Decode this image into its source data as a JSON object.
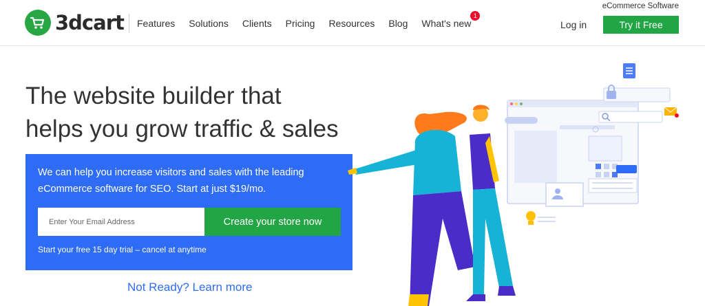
{
  "brand": {
    "logo_text": "3dcart",
    "tagline": "eCommerce Software",
    "colors": {
      "green": "#22a544",
      "blue": "#2f6cf6"
    }
  },
  "nav": {
    "items": [
      {
        "label": "Features"
      },
      {
        "label": "Solutions"
      },
      {
        "label": "Clients"
      },
      {
        "label": "Pricing"
      },
      {
        "label": "Resources"
      },
      {
        "label": "Blog"
      },
      {
        "label": "What's new",
        "badge": "1"
      }
    ],
    "login_label": "Log in",
    "try_label": "Try it Free"
  },
  "hero": {
    "title_line1": "The website builder that",
    "title_line2": "helps you grow traffic & sales",
    "description": "We can help you increase visitors and sales with the leading eCommerce software for SEO. Start at just $19/mo.",
    "email_placeholder": "Enter Your Email Address",
    "cta_label": "Create your store now",
    "trial_text": "Start your free 15 day trial – cancel at anytime",
    "learn_more": "Not Ready? Learn more"
  },
  "icons": [
    "shopping-cart-icon",
    "document-icon",
    "lock-icon",
    "search-icon",
    "mail-icon",
    "user-icon",
    "lightbulb-icon"
  ]
}
